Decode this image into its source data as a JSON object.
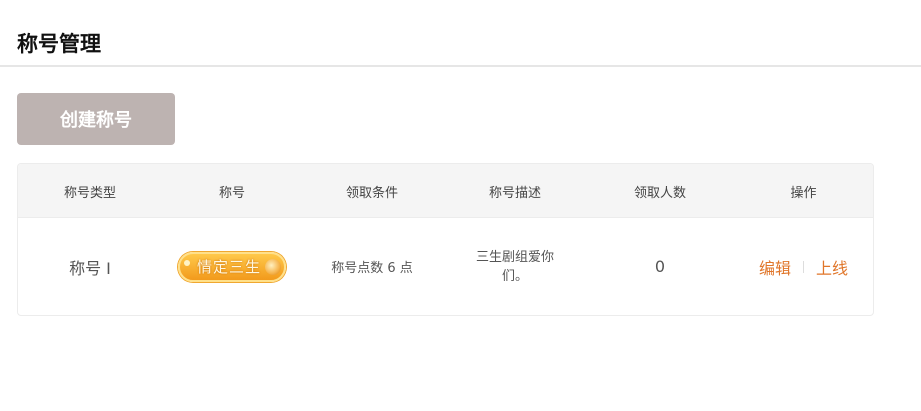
{
  "page": {
    "title": "称号管理"
  },
  "toolbar": {
    "create_label": "创建称号"
  },
  "table": {
    "columns": [
      "称号类型",
      "称号",
      "领取条件",
      "称号描述",
      "领取人数",
      "操作"
    ],
    "rows": [
      {
        "type": "称号 I",
        "badge_text": "情定三生",
        "condition": "称号点数 6 点",
        "description": "三生剧组爱你们。",
        "count": "0",
        "actions": {
          "edit": "编辑",
          "online": "上线"
        }
      }
    ]
  },
  "colors": {
    "accent": "#e0762a",
    "button_bg": "#bdb3b1",
    "header_bg": "#f5f5f5"
  }
}
